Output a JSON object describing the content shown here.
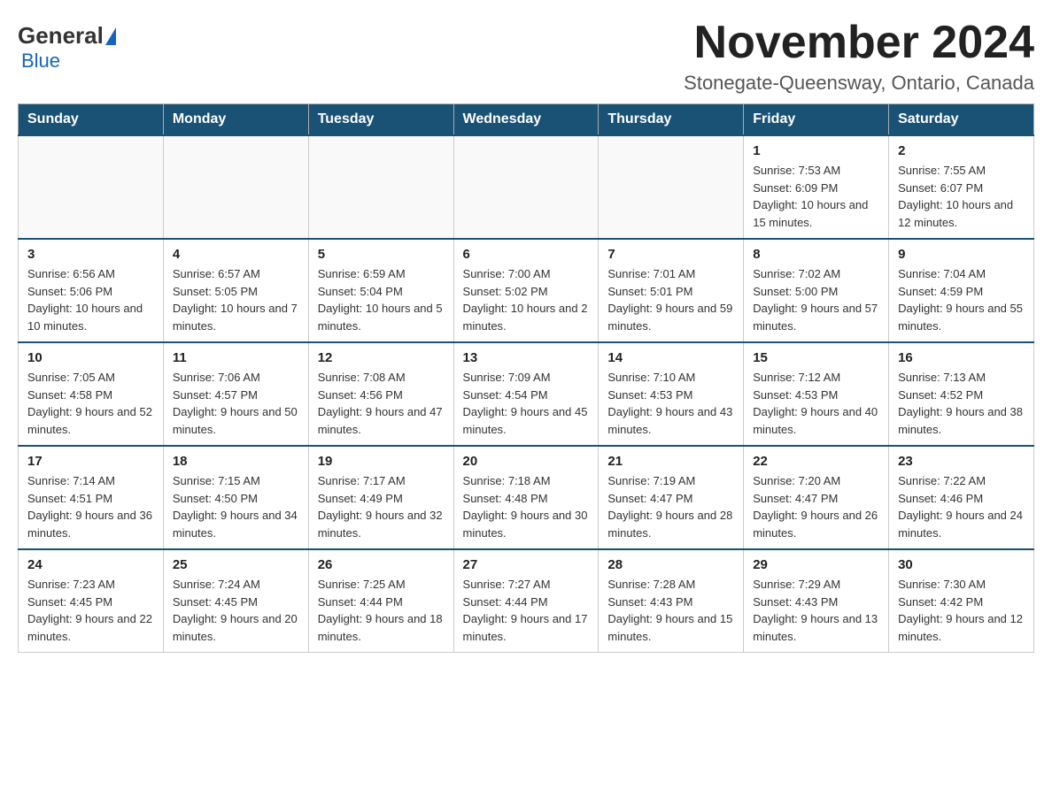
{
  "header": {
    "logo": {
      "general": "General",
      "blue": "Blue"
    },
    "title": "November 2024",
    "subtitle": "Stonegate-Queensway, Ontario, Canada"
  },
  "calendar": {
    "days_of_week": [
      "Sunday",
      "Monday",
      "Tuesday",
      "Wednesday",
      "Thursday",
      "Friday",
      "Saturday"
    ],
    "weeks": [
      [
        {
          "day": "",
          "info": ""
        },
        {
          "day": "",
          "info": ""
        },
        {
          "day": "",
          "info": ""
        },
        {
          "day": "",
          "info": ""
        },
        {
          "day": "",
          "info": ""
        },
        {
          "day": "1",
          "info": "Sunrise: 7:53 AM\nSunset: 6:09 PM\nDaylight: 10 hours and 15 minutes."
        },
        {
          "day": "2",
          "info": "Sunrise: 7:55 AM\nSunset: 6:07 PM\nDaylight: 10 hours and 12 minutes."
        }
      ],
      [
        {
          "day": "3",
          "info": "Sunrise: 6:56 AM\nSunset: 5:06 PM\nDaylight: 10 hours and 10 minutes."
        },
        {
          "day": "4",
          "info": "Sunrise: 6:57 AM\nSunset: 5:05 PM\nDaylight: 10 hours and 7 minutes."
        },
        {
          "day": "5",
          "info": "Sunrise: 6:59 AM\nSunset: 5:04 PM\nDaylight: 10 hours and 5 minutes."
        },
        {
          "day": "6",
          "info": "Sunrise: 7:00 AM\nSunset: 5:02 PM\nDaylight: 10 hours and 2 minutes."
        },
        {
          "day": "7",
          "info": "Sunrise: 7:01 AM\nSunset: 5:01 PM\nDaylight: 9 hours and 59 minutes."
        },
        {
          "day": "8",
          "info": "Sunrise: 7:02 AM\nSunset: 5:00 PM\nDaylight: 9 hours and 57 minutes."
        },
        {
          "day": "9",
          "info": "Sunrise: 7:04 AM\nSunset: 4:59 PM\nDaylight: 9 hours and 55 minutes."
        }
      ],
      [
        {
          "day": "10",
          "info": "Sunrise: 7:05 AM\nSunset: 4:58 PM\nDaylight: 9 hours and 52 minutes."
        },
        {
          "day": "11",
          "info": "Sunrise: 7:06 AM\nSunset: 4:57 PM\nDaylight: 9 hours and 50 minutes."
        },
        {
          "day": "12",
          "info": "Sunrise: 7:08 AM\nSunset: 4:56 PM\nDaylight: 9 hours and 47 minutes."
        },
        {
          "day": "13",
          "info": "Sunrise: 7:09 AM\nSunset: 4:54 PM\nDaylight: 9 hours and 45 minutes."
        },
        {
          "day": "14",
          "info": "Sunrise: 7:10 AM\nSunset: 4:53 PM\nDaylight: 9 hours and 43 minutes."
        },
        {
          "day": "15",
          "info": "Sunrise: 7:12 AM\nSunset: 4:53 PM\nDaylight: 9 hours and 40 minutes."
        },
        {
          "day": "16",
          "info": "Sunrise: 7:13 AM\nSunset: 4:52 PM\nDaylight: 9 hours and 38 minutes."
        }
      ],
      [
        {
          "day": "17",
          "info": "Sunrise: 7:14 AM\nSunset: 4:51 PM\nDaylight: 9 hours and 36 minutes."
        },
        {
          "day": "18",
          "info": "Sunrise: 7:15 AM\nSunset: 4:50 PM\nDaylight: 9 hours and 34 minutes."
        },
        {
          "day": "19",
          "info": "Sunrise: 7:17 AM\nSunset: 4:49 PM\nDaylight: 9 hours and 32 minutes."
        },
        {
          "day": "20",
          "info": "Sunrise: 7:18 AM\nSunset: 4:48 PM\nDaylight: 9 hours and 30 minutes."
        },
        {
          "day": "21",
          "info": "Sunrise: 7:19 AM\nSunset: 4:47 PM\nDaylight: 9 hours and 28 minutes."
        },
        {
          "day": "22",
          "info": "Sunrise: 7:20 AM\nSunset: 4:47 PM\nDaylight: 9 hours and 26 minutes."
        },
        {
          "day": "23",
          "info": "Sunrise: 7:22 AM\nSunset: 4:46 PM\nDaylight: 9 hours and 24 minutes."
        }
      ],
      [
        {
          "day": "24",
          "info": "Sunrise: 7:23 AM\nSunset: 4:45 PM\nDaylight: 9 hours and 22 minutes."
        },
        {
          "day": "25",
          "info": "Sunrise: 7:24 AM\nSunset: 4:45 PM\nDaylight: 9 hours and 20 minutes."
        },
        {
          "day": "26",
          "info": "Sunrise: 7:25 AM\nSunset: 4:44 PM\nDaylight: 9 hours and 18 minutes."
        },
        {
          "day": "27",
          "info": "Sunrise: 7:27 AM\nSunset: 4:44 PM\nDaylight: 9 hours and 17 minutes."
        },
        {
          "day": "28",
          "info": "Sunrise: 7:28 AM\nSunset: 4:43 PM\nDaylight: 9 hours and 15 minutes."
        },
        {
          "day": "29",
          "info": "Sunrise: 7:29 AM\nSunset: 4:43 PM\nDaylight: 9 hours and 13 minutes."
        },
        {
          "day": "30",
          "info": "Sunrise: 7:30 AM\nSunset: 4:42 PM\nDaylight: 9 hours and 12 minutes."
        }
      ]
    ]
  }
}
